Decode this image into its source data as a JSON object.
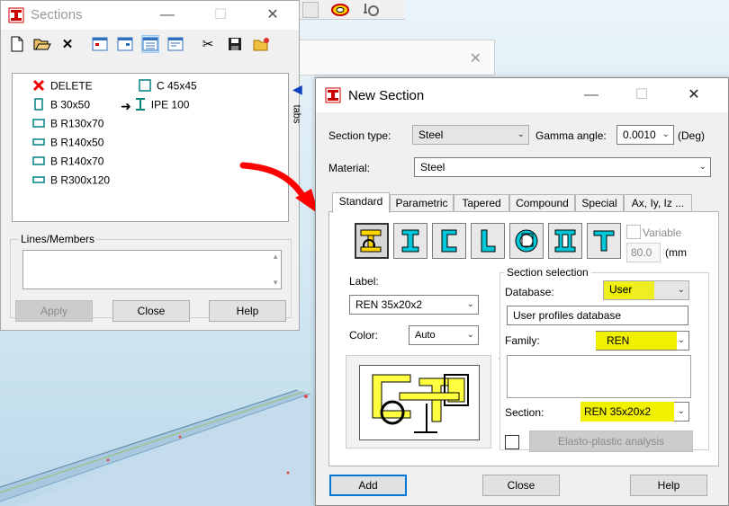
{
  "sections_window": {
    "title": "Sections",
    "toolbar": [
      "new-icon",
      "open-icon",
      "delete-icon",
      "view1-icon",
      "view2-icon",
      "view3-icon",
      "view4-icon",
      "cut-icon",
      "save-icon",
      "folder-star-icon"
    ],
    "list": [
      {
        "label": "DELETE",
        "icon": "red-x-icon"
      },
      {
        "label": "B 30x50",
        "icon": "rect-tall-icon"
      },
      {
        "label": "B R130x70",
        "icon": "rect-wide-icon"
      },
      {
        "label": "B R140x50",
        "icon": "rect-wide-icon"
      },
      {
        "label": "B R140x70",
        "icon": "rect-wide-icon"
      },
      {
        "label": "B R300x120",
        "icon": "rect-wide-icon"
      },
      {
        "label": "C 45x45",
        "icon": "square-icon"
      },
      {
        "label": "IPE 100",
        "icon": "i-beam-icon",
        "current": true
      }
    ],
    "lines_label": "Lines/Members",
    "buttons": {
      "apply": "Apply",
      "close": "Close",
      "help": "Help"
    },
    "side_tab": "tabs"
  },
  "new_section": {
    "title": "New Section",
    "section_type_label": "Section type:",
    "section_type_value": "Steel",
    "gamma_label": "Gamma angle:",
    "gamma_value": "0.0010",
    "gamma_unit": "(Deg)",
    "material_label": "Material:",
    "material_value": "Steel",
    "tabs": [
      "Standard",
      "Parametric",
      "Tapered",
      "Compound",
      "Special",
      "Ax, Iy, Iz ..."
    ],
    "active_tab": "Standard",
    "variable_label": "Variable",
    "variable_value": "80.0",
    "variable_unit": "(mm",
    "label_label": "Label:",
    "label_value": "REN 35x20x2",
    "color_label": "Color:",
    "color_value": "Auto",
    "section_selection_title": "Section selection",
    "database_label": "Database:",
    "database_value": "User",
    "database_desc": "User profiles database",
    "family_label": "Family:",
    "family_value": "REN",
    "section_label": "Section:",
    "section_value": "REN 35x20x2",
    "elasto_plastic": "Elasto-plastic analysis",
    "buttons": {
      "add": "Add",
      "close": "Close",
      "help": "Help"
    }
  },
  "colors": {
    "highlight": "#f0f000",
    "accent": "#0078d7",
    "arrow": "#ff0000",
    "shape_cyan": "#00c8d8"
  }
}
